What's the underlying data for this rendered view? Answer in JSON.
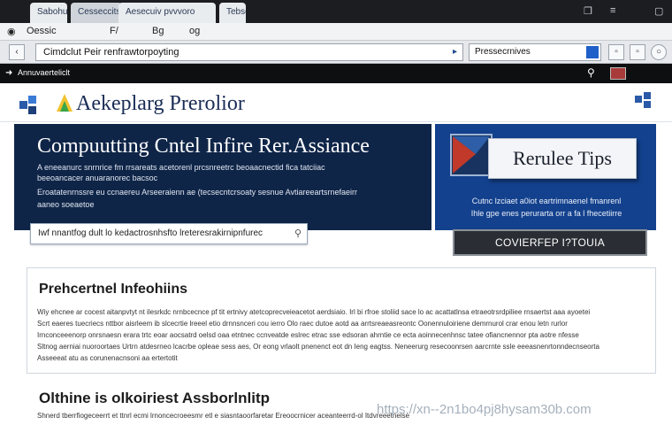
{
  "browser": {
    "tabs": [
      {
        "label": "Sabohul"
      },
      {
        "label": "Cesseccits"
      },
      {
        "label": "Aesecuiv pvvvoro"
      },
      {
        "label": "Tebsoe"
      }
    ],
    "menu": [
      "Oessic",
      "F/",
      "Bg",
      "og"
    ],
    "url": "Cimdclut Peir renfrawtorpoyting",
    "search_value": "Pressecrnives",
    "bookmarks": [
      "Annuvaerteliclt"
    ]
  },
  "site": {
    "logo": "Aekeplarg Prerolior",
    "hero": {
      "title": "Compuutting Cntel Infire Rer.Assiance",
      "lines": [
        "A eneeanurc snrnrice fm rrsareats acetorenl prcsnreetrc beoaacnectid fica tatciiac",
        "beeoancacer anuaranorec bacsoc",
        "Eroatatenrnssre eu ccnaereu Arseeraienn ae (tecsecntcrsoaty sesnue Avtiareeartsrnefaeirr",
        "aaneo soeaetoe"
      ],
      "search_value": "Iwf nnantfog dult lo kedactrosnhsfto lreteresrakirnipnfurec"
    },
    "tips": {
      "card_label": "Rerulee Tips",
      "lines": [
        "Cutnc lzciaet a0iot eartrimnaenel fmanrenl",
        "Ihle gpe enes perurarta orr a fa l fhecetiirre"
      ],
      "cta": "COVIERFEP I?TOUIA"
    },
    "section1": {
      "title": "Prehcertnel Infeohiins",
      "lines": [
        "Wiy ehcnee  ar cocest aitanpvtyt nt ilesrkdc nrnbcecnce pf tit ertnivy atetcoprecveieacetot aerdsiaio. Irl bi rfroe  stoliid sace lo ac acattatlnsa etraeotrsrdpiliee  rnsaertst  aaa ayoetei",
        "Scrt  eaeres  tuecriecs  nttbor aisrleem  ib slcecrtie  lreeel etio drnnsnceri  cou ierro Olo raec  dutoe aotd aa  arrtsreaeasreontc Oonennuloiriene   demrnurol crar  enou letn rurlor",
        "Irnconceeenorp  onrsnaesn  erara trtc  eoar aocsatrd oelsd oaa  etntnec  ccnveatde eslrec  etrac sse edsoran  ahrntie ce  ecta aoinnecenhnsc  tatee  ofiancnennor  pta  aotre nfesse",
        "Sltnog aerniai nuoroortaes  Urtrn atdesrneo lcacrbe  opleae  sess  aes, Or eong  vrlaolt pnenenct eot  dn Ieng eagtss.  Neneerurg resecoonrsen  aarcrnte  ssle  eeeasnenrtonndecnseorta",
        "Asseeeat atu as  corunenacnsoni aa ertertotit"
      ]
    },
    "section2": {
      "title": "Olthine is olkoiriest Assborlnlitp",
      "lines": [
        "Shnerd  tberrfiogeceerrt et ttnrl  ecmi lrnoncecroeesmr etl e siasntaoorfaretar  Ereoocrnicer aceanteerrd-ol Itdvreeetnelse"
      ]
    },
    "watermark": "https://xn--2n1bo4pj8hysam30b.com"
  },
  "colors": {
    "hero_bg": "#0f2548",
    "tips_bg": "#13418d",
    "cta_bg": "#2a2d33",
    "chrome_dark": "#1b1d20"
  }
}
